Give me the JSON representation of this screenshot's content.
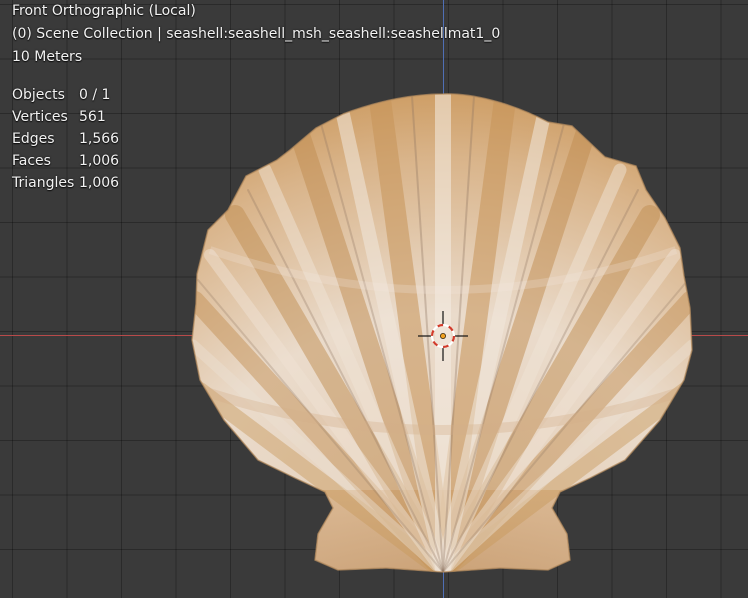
{
  "viewport": {
    "view_name": "Front Orthographic (Local)",
    "collection_info": "(0) Scene Collection | seashell:seashell_msh_seashell:seashellmat1_0",
    "grid_scale": "10 Meters"
  },
  "stats": [
    {
      "label": "Objects",
      "value": "0 / 1"
    },
    {
      "label": "Vertices",
      "value": "561"
    },
    {
      "label": "Edges",
      "value": "1,566"
    },
    {
      "label": "Faces",
      "value": "1,006"
    },
    {
      "label": "Triangles",
      "value": "1,006"
    }
  ],
  "colors": {
    "background": "#3a3a3a",
    "x_axis": "#b84a4a",
    "z_axis": "#4f6fb5",
    "shell_base": "#e8d4bc",
    "shell_rib_tan": "#c99a5e",
    "shell_highlight": "#f4ece4"
  }
}
